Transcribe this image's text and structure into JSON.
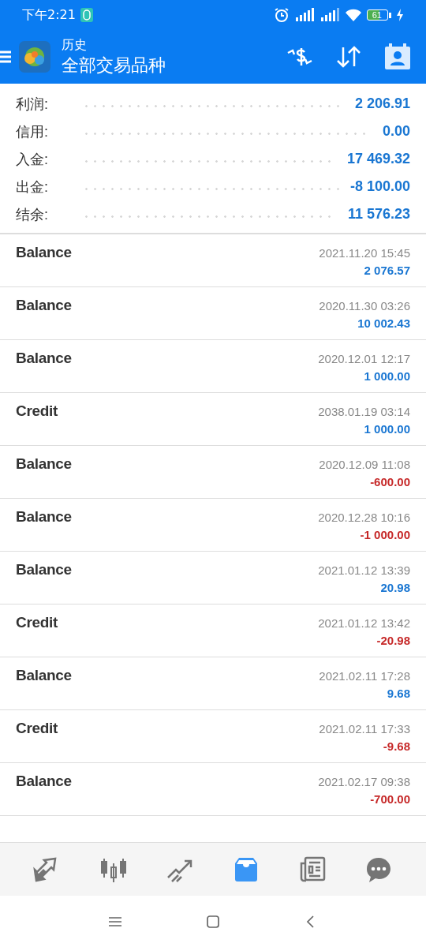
{
  "status_bar": {
    "time": "下午2:21",
    "battery": "61"
  },
  "header": {
    "subtitle": "历史",
    "title": "全部交易品种"
  },
  "summary": [
    {
      "label": "利润:",
      "value": "2 206.91"
    },
    {
      "label": "信用:",
      "value": "0.00"
    },
    {
      "label": "入金:",
      "value": "17 469.32"
    },
    {
      "label": "出金:",
      "value": "-8 100.00"
    },
    {
      "label": "结余:",
      "value": "11 576.23"
    }
  ],
  "transactions": [
    {
      "type": "Balance",
      "time": "2021.11.20 15:45",
      "amount": "2 076.57",
      "color": "#1976d2"
    },
    {
      "type": "Balance",
      "time": "2020.11.30 03:26",
      "amount": "10 002.43",
      "color": "#1976d2"
    },
    {
      "type": "Balance",
      "time": "2020.12.01 12:17",
      "amount": "1 000.00",
      "color": "#1976d2"
    },
    {
      "type": "Credit",
      "time": "2038.01.19 03:14",
      "amount": "1 000.00",
      "color": "#1976d2"
    },
    {
      "type": "Balance",
      "time": "2020.12.09 11:08",
      "amount": "-600.00",
      "color": "#c62828"
    },
    {
      "type": "Balance",
      "time": "2020.12.28 10:16",
      "amount": "-1 000.00",
      "color": "#c62828"
    },
    {
      "type": "Balance",
      "time": "2021.01.12 13:39",
      "amount": "20.98",
      "color": "#1976d2"
    },
    {
      "type": "Credit",
      "time": "2021.01.12 13:42",
      "amount": "-20.98",
      "color": "#c62828"
    },
    {
      "type": "Balance",
      "time": "2021.02.11 17:28",
      "amount": "9.68",
      "color": "#1976d2"
    },
    {
      "type": "Credit",
      "time": "2021.02.11 17:33",
      "amount": "-9.68",
      "color": "#c62828"
    },
    {
      "type": "Balance",
      "time": "2021.02.17 09:38",
      "amount": "-700.00",
      "color": "#c62828"
    }
  ],
  "bottom_nav": [
    {
      "kind": "quotes",
      "selected": false
    },
    {
      "kind": "chart",
      "selected": false
    },
    {
      "kind": "trade",
      "selected": false
    },
    {
      "kind": "history",
      "selected": true
    },
    {
      "kind": "news",
      "selected": false
    },
    {
      "kind": "chat",
      "selected": false
    }
  ]
}
